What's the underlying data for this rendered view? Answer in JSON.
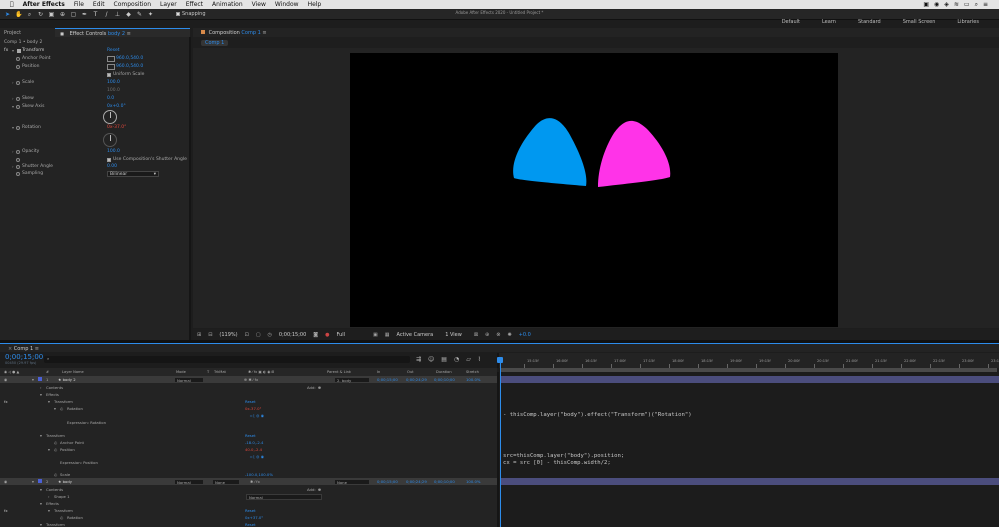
{
  "menubar": {
    "app": "After Effects",
    "items": [
      "File",
      "Edit",
      "Composition",
      "Layer",
      "Effect",
      "Animation",
      "View",
      "Window",
      "Help"
    ]
  },
  "window_title": "Adobe After Effects 2020 - Untitled Project *",
  "toolbar": {
    "snapping": "Snapping"
  },
  "workspaces": [
    "Default",
    "Learn",
    "Standard",
    "Small Screen",
    "Libraries"
  ],
  "project_tab": "Project",
  "effect_controls": {
    "tab_prefix": "Effect Controls",
    "tab_layer": "body 2",
    "path": "Comp 1 • body 2",
    "fx": "fx",
    "effect_name": "Transform",
    "reset": "Reset",
    "props": [
      {
        "label": "Anchor Point",
        "value": "960.0,540.0"
      },
      {
        "label": "Position",
        "value": "960.0,540.0"
      },
      {
        "label": "",
        "value": "Uniform Scale"
      },
      {
        "label": "Scale",
        "value": "100.0"
      },
      {
        "label": "",
        "value": "100.0"
      },
      {
        "label": "Skew",
        "value": "0.0"
      },
      {
        "label": "Skew Axis",
        "value": "0x+0.0°"
      },
      {
        "label": "Rotation",
        "value": "0x-37.0°"
      },
      {
        "label": "Opacity",
        "value": "100.0"
      },
      {
        "label": "",
        "value": "Use Composition's Shutter Angle"
      },
      {
        "label": "Shutter Angle",
        "value": "0.00"
      },
      {
        "label": "Sampling",
        "value": "Bilinear"
      }
    ]
  },
  "composition": {
    "tab_prefix": "Composition",
    "tab_name": "Comp 1",
    "subtab": "Comp 1"
  },
  "shapes": {
    "left_color": "#0098f0",
    "right_color": "#ff33e8"
  },
  "viewer_footer": {
    "zoom": "(119%)",
    "timecode": "0;00;15;00",
    "res": "Full",
    "camera": "Active Camera",
    "views": "1 View",
    "offset": "+0.0"
  },
  "timeline": {
    "tab": "Comp 1",
    "timecode": "0;00;15;00",
    "fps": "00450 (29.97 fps)",
    "columns": [
      "#",
      "Layer Name",
      "Mode",
      "T",
      "TrkMat",
      "Parent & Link",
      "In",
      "Out",
      "Duration",
      "Stretch"
    ],
    "ruler": [
      "15:15f",
      "16:00f",
      "16:15f",
      "17:00f",
      "17:15f",
      "18:00f",
      "18:15f",
      "19:00f",
      "19:15f",
      "20:00f",
      "20:15f",
      "21:00f",
      "21:15f",
      "22:00f",
      "22:15f",
      "23:00f",
      "23:15"
    ],
    "rows": [
      {
        "name": "body 2",
        "num": "1",
        "mode": "Normal",
        "parent": "2. body",
        "in": "0;00;15;00",
        "out": "0;00;24;29",
        "dur": "0;00;10;00",
        "stretch": "100.0%"
      },
      {
        "name": "body",
        "num": "2",
        "mode": "Normal",
        "trkmat": "None",
        "parent": "None",
        "in": "0;00;15;00",
        "out": "0;00;24;29",
        "dur": "0;00;10;00",
        "stretch": "100.0%"
      }
    ],
    "sub": {
      "contents": "Contents",
      "add": "Add:",
      "effects": "Effects",
      "transform": "Transform",
      "reset": "Reset",
      "rotation": "Rotation",
      "rot_val": "0x-37.0°",
      "expr_rot": "Expression: Rotation",
      "anchor": "Anchor Point",
      "anchor_val": "-18.0,-2.4",
      "position": "Position",
      "pos_val": "40.0,-2.4",
      "expr_pos": "Expression: Position",
      "scale": "Scale",
      "scale_val": "-100.0,100.0%",
      "shape1": "Shape 1",
      "normal": "Normal",
      "rot2_val": "0x+37.0°"
    },
    "expr1": "- thisComp.layer(\"body\").effect(\"Transform\")(\"Rotation\")",
    "expr2a": "src=thisComp.layer(\"body\").position;",
    "expr2b": "cx = src [0] - thisComp.width/2;"
  }
}
